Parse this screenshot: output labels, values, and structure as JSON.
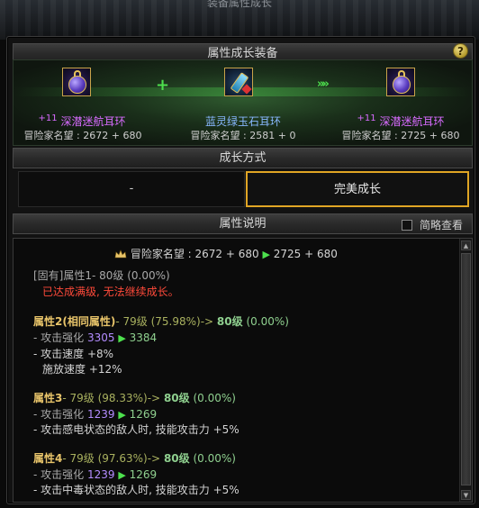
{
  "window": {
    "title": "装备属性成长"
  },
  "help_label": "?",
  "upgrade_section": {
    "title": "属性成长装备"
  },
  "items": [
    {
      "plus": "+11",
      "name": "深潜迷航耳环",
      "fame": "冒险家名望 : 2672 + 680"
    },
    {
      "plus": "",
      "name": "蓝灵绿玉石耳环",
      "fame": "冒险家名望 : 2581 + 0"
    },
    {
      "plus": "+11",
      "name": "深潜迷航耳环",
      "fame": "冒险家名望 : 2725 + 680"
    }
  ],
  "connectors": {
    "plus": "+",
    "arrow": "»»"
  },
  "growth_mode": {
    "title": "成长方式",
    "options": [
      {
        "label": "-",
        "selected": false
      },
      {
        "label": "完美成长",
        "selected": true
      }
    ]
  },
  "description": {
    "title": "属性说明",
    "brief_view": {
      "label": "简略查看",
      "checked": false
    },
    "fame_line": {
      "from": "冒险家名望 : 2672 + 680",
      "to": "2725 + 680"
    },
    "fixed_attr": {
      "title": "[固有]属性1- 80级 (0.00%)",
      "note": "已达成满级, 无法继续成长。"
    },
    "attributes": [
      {
        "title_prefix": "属性2",
        "title_tag": "(相同属性)",
        "title_level": "- 79级 (75.98%)",
        "arrow": "->",
        "title_target": "80级",
        "title_target_pct": "(0.00%)",
        "lines": [
          {
            "label": "- 攻击强化",
            "from": "3305",
            "to": "3384"
          },
          {
            "label": "- 攻击速度 +8%"
          },
          {
            "label": "  施放速度 +12%"
          }
        ]
      },
      {
        "title_prefix": "属性3",
        "title_tag": "",
        "title_level": "- 79级 (98.33%)",
        "arrow": "->",
        "title_target": "80级",
        "title_target_pct": "(0.00%)",
        "lines": [
          {
            "label": "- 攻击强化",
            "from": "1239",
            "to": "1269"
          },
          {
            "label": "- 攻击感电状态的敌人时, 技能攻击力 +5%"
          }
        ]
      },
      {
        "title_prefix": "属性4",
        "title_tag": "",
        "title_level": "- 79级 (97.63%)",
        "arrow": "->",
        "title_target": "80级",
        "title_target_pct": "(0.00%)",
        "lines": [
          {
            "label": "- 攻击强化",
            "from": "1239",
            "to": "1269"
          },
          {
            "label": "- 攻击中毒状态的敌人时, 技能攻击力 +5%"
          }
        ]
      }
    ]
  },
  "colors": {
    "gold": "#e8c46a",
    "selected_border": "#e0a524",
    "green": "#4de04d",
    "purple": "#d86bff",
    "blue": "#88b8ff",
    "red": "#ff4a3a"
  }
}
